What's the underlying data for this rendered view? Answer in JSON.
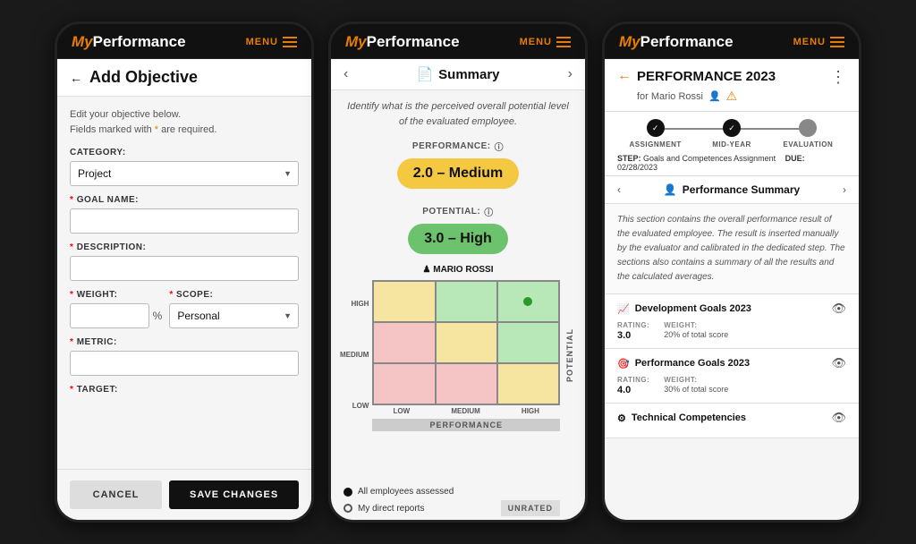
{
  "app": {
    "name_prefix": "My",
    "name_suffix": "Performance",
    "menu_label": "MENU"
  },
  "screen1": {
    "title": "Add Objective",
    "back_label": "←",
    "note": "Edit your objective below.",
    "note2": "Fields marked with * are required.",
    "required_marker": "*",
    "category_label": "CATEGORY:",
    "category_value": "Project",
    "goal_name_label": "GOAL NAME:",
    "description_label": "DESCRIPTION:",
    "weight_label": "WEIGHT:",
    "pct": "%",
    "scope_label": "SCOPE:",
    "scope_value": "Personal",
    "metric_label": "METRIC:",
    "target_label": "TARGET:",
    "cancel_btn": "CANCEL",
    "save_btn": "SAVE CHANGES"
  },
  "screen2": {
    "title": "Summary",
    "nav_left": "‹",
    "nav_right": "›",
    "doc_icon": "📄",
    "subtitle": "Identify what is the perceived overall potential level of the evaluated employee.",
    "performance_label": "PERFORMANCE:",
    "performance_badge": "2.0 – Medium",
    "potential_label": "POTENTIAL:",
    "potential_badge": "3.0 – High",
    "mario_label": "♟ MARIO ROSSI",
    "y_axis_label": "POTENTIAL",
    "x_axis_label": "PERFORMANCE",
    "y_levels": [
      "HIGH",
      "MEDIUM",
      "LOW"
    ],
    "x_levels": [
      "LOW",
      "MEDIUM",
      "HIGH"
    ],
    "legend_all": "All employees assessed",
    "legend_direct": "My direct reports",
    "unrated_label": "UNRATED"
  },
  "screen3": {
    "back_arrow": "←",
    "title": "PERFORMANCE 2023",
    "subtitle": "for Mario Rossi",
    "person_icon": "👤",
    "warning_icon": "⚠",
    "three_dots": "⋮",
    "steps": [
      {
        "label": "ASSIGNMENT",
        "state": "active",
        "icon": "✓"
      },
      {
        "label": "MID-YEAR",
        "state": "completed",
        "icon": "✓"
      },
      {
        "label": "EVALUATION",
        "state": "pending",
        "icon": ""
      }
    ],
    "step_info_label": "STEP:",
    "step_info_value": "Goals and Competences Assignment",
    "due_label": "DUE:",
    "due_value": "02/28/2023",
    "section_nav_left": "‹",
    "section_title": "Performance Summary",
    "section_nav_right": "›",
    "section_icon": "👤",
    "section_chevron": "›",
    "description": "This section contains the overall performance result of the evaluated employee. The result is inserted manually by the evaluator and calibrated in the dedicated step. The sections also contains a summary of all the results and the calculated averages.",
    "goals": [
      {
        "icon": "📈",
        "title": "Development Goals 2023",
        "rating_label": "RATING:",
        "rating_value": "3.0",
        "weight_label": "WEIGHT:",
        "weight_value": "20% of total score"
      },
      {
        "icon": "🎯",
        "title": "Performance Goals 2023",
        "rating_label": "RATING:",
        "rating_value": "4.0",
        "weight_label": "WEIGHT:",
        "weight_value": "30% of total score"
      },
      {
        "icon": "⚙",
        "title": "Technical Competencies",
        "rating_label": "",
        "rating_value": "",
        "weight_label": "",
        "weight_value": ""
      }
    ]
  }
}
